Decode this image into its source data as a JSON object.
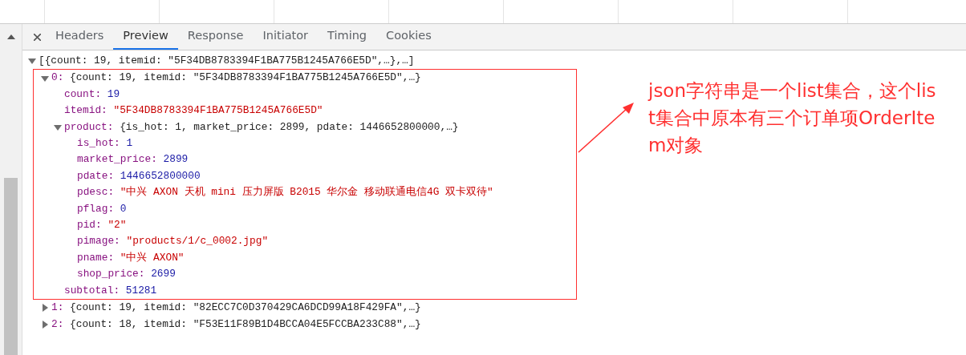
{
  "tabs": [
    {
      "label": "Headers",
      "selected": false
    },
    {
      "label": "Preview",
      "selected": true
    },
    {
      "label": "Response",
      "selected": false
    },
    {
      "label": "Initiator",
      "selected": false
    },
    {
      "label": "Timing",
      "selected": false
    },
    {
      "label": "Cookies",
      "selected": false
    }
  ],
  "tree": {
    "summary": "[{count: 19, itemid: \"5F34DB8783394F1BA775B1245A766E5D\",…},…]",
    "expanded": true,
    "children": [
      {
        "key": "0:",
        "summary": "{count: 19, itemid: \"5F34DB8783394F1BA775B1245A766E5D\",…}",
        "expanded": true,
        "highlighted": true,
        "children": [
          {
            "key": "count:",
            "value": "19",
            "kind": "number"
          },
          {
            "key": "itemid:",
            "value": "\"5F34DB8783394F1BA775B1245A766E5D\"",
            "kind": "string"
          },
          {
            "key": "product:",
            "summary": "{is_hot: 1, market_price: 2899, pdate: 1446652800000,…}",
            "expanded": true,
            "highlighted": false,
            "children": [
              {
                "key": "is_hot:",
                "value": "1",
                "kind": "number"
              },
              {
                "key": "market_price:",
                "value": "2899",
                "kind": "number"
              },
              {
                "key": "pdate:",
                "value": "1446652800000",
                "kind": "number"
              },
              {
                "key": "pdesc:",
                "value": "\"中兴 AXON 天机 mini 压力屏版 B2015 华尔金 移动联通电信4G 双卡双待\"",
                "kind": "string"
              },
              {
                "key": "pflag:",
                "value": "0",
                "kind": "number"
              },
              {
                "key": "pid:",
                "value": "\"2\"",
                "kind": "string"
              },
              {
                "key": "pimage:",
                "value": "\"products/1/c_0002.jpg\"",
                "kind": "string"
              },
              {
                "key": "pname:",
                "value": "\"中兴 AXON\"",
                "kind": "string"
              },
              {
                "key": "shop_price:",
                "value": "2699",
                "kind": "number"
              }
            ]
          },
          {
            "key": "subtotal:",
            "value": "51281",
            "kind": "number"
          }
        ]
      },
      {
        "key": "1:",
        "summary": "{count: 19, itemid: \"82ECC7C0D370429CA6DCD99A18F429FA\",…}",
        "expanded": false,
        "highlighted": false
      },
      {
        "key": "2:",
        "summary": "{count: 18, itemid: \"F53E11F89B1D4BCCA04E5FCCBA233C88\",…}",
        "expanded": false,
        "highlighted": false
      }
    ]
  },
  "annotation": "json字符串是一个list集合，这个list集合中原本有三个订单项OrderItem对象"
}
